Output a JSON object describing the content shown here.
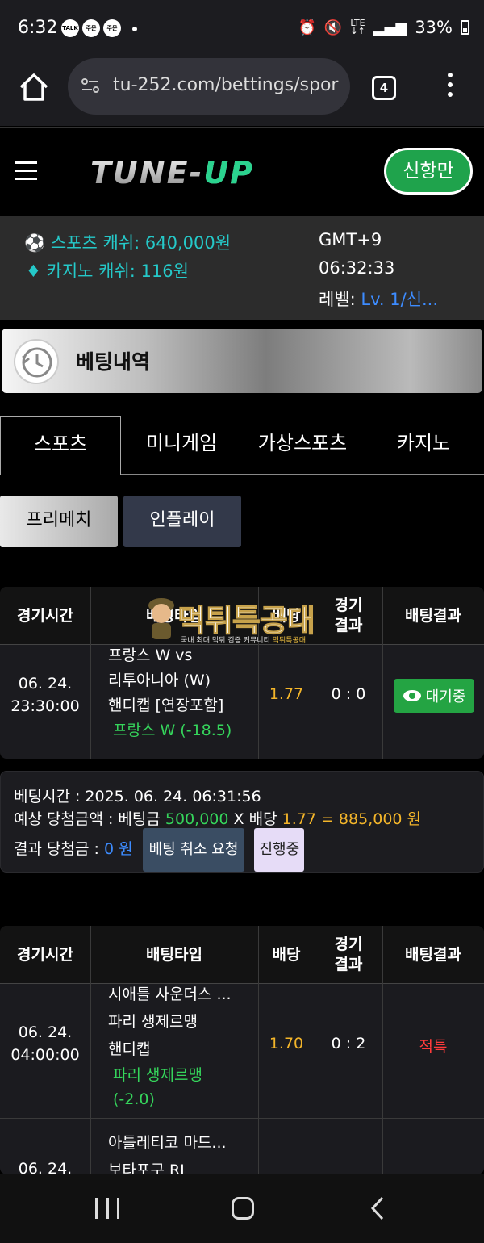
{
  "status_bar": {
    "time": "6:32",
    "notif_1": "TALK",
    "notif_2": "주문",
    "notif_3": "주문",
    "battery": "33%"
  },
  "browser": {
    "url": "tu-252.com/bettings/spor",
    "tab_count": "4"
  },
  "header": {
    "logo_main": "TUNE-",
    "logo_accent": "UP",
    "user_button": "신항만"
  },
  "info": {
    "sports_cash": "스포츠 캐쉬: 640,000원",
    "casino_cash": "카지노 캐쉬: 116원",
    "timezone": "GMT+9",
    "clock": "06:32:33",
    "level_label": "레벨:",
    "level_value": "Lv. 1/신..."
  },
  "section": {
    "title": "베팅내역"
  },
  "tabs": [
    "스포츠",
    "미니게임",
    "가상스포츠",
    "카지노"
  ],
  "subtabs": [
    "프리메치",
    "인플레이"
  ],
  "table_headers": {
    "time": "경기시간",
    "type": "배팅타입",
    "odds": "배당",
    "result_1": "경기",
    "result_2": "결과",
    "bet_result": "배팅결과"
  },
  "bet1": {
    "date": "06. 24.",
    "time": "23:30:00",
    "line1": "프랑스 W vs",
    "line2": "리투아니아 (W)",
    "line3": "핸디캡 [연장포함]",
    "pick": "프랑스 W (-18.5)",
    "odds": "1.77",
    "score": "0 : 0",
    "status": "대기중",
    "bet_time": "베팅시간 : 2025. 06. 24. 06:31:56",
    "expected_prefix": "예상 당첨금액 : 베팅금",
    "stake": "500,000",
    "x": "X",
    "odds_label": "배당",
    "odds2": "1.77",
    "payout": "= 885,000 원",
    "result_prefix": "결과 당첨금 :",
    "result_amount": "0 원",
    "cancel_btn": "베팅 취소 요청",
    "progress_btn": "진행중"
  },
  "bet2": {
    "date": "06. 24.",
    "time": "04:00:00",
    "line1": "시애틀 사운더스 ...",
    "line2": "파리 생제르맹",
    "line3": "핸디캡",
    "pick1": "파리 생제르맹",
    "pick2": "(-2.0)",
    "odds": "1.70",
    "score": "0 : 2",
    "status": "적특"
  },
  "bet3": {
    "date": "06. 24.",
    "line1": "아틀레티코 마드...",
    "line2": "보타포구 RJ"
  },
  "watermark": {
    "title": "먹튀특공대",
    "sub_white": "국내 최대 먹튀 검증 커뮤니티",
    "sub_yellow": "먹튀특공대"
  },
  "colors": {
    "accent_green": "#1fa34c",
    "cyan": "#25c9c9",
    "odds_gold": "#f3b52a",
    "win_green": "#35d45b",
    "red": "#ff3b3b",
    "link_blue": "#3d8cff"
  }
}
